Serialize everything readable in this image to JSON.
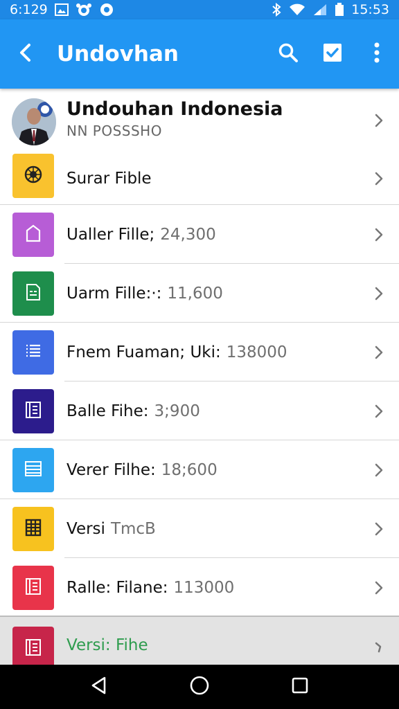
{
  "status_bar": {
    "time_left": "6:129",
    "time_right": "15:53",
    "colors": {
      "background": "#1e88e5"
    }
  },
  "app_bar": {
    "title": "Undovhan",
    "background": "#2196f3",
    "icons": [
      "back-arrow-icon",
      "search-icon",
      "checkbox-icon",
      "more-vert-icon"
    ]
  },
  "profile": {
    "name": "Undouhan Indonesia",
    "subtitle": "NN POSSSHO"
  },
  "items": [
    {
      "label": "Surar Fible",
      "value": "",
      "color": "#f9c22e",
      "icon": "gear-pattern-icon"
    },
    {
      "label": "Ualler Fille;",
      "value": "24,300",
      "color": "#b75dd6",
      "icon": "bag-icon"
    },
    {
      "label": "Uarm Fille:·:",
      "value": "11,600",
      "color": "#1e8e4c",
      "icon": "document-icon"
    },
    {
      "label": "Fnem Fuaman; Uki:",
      "value": "138000",
      "color": "#3f6be4",
      "icon": "list-icon"
    },
    {
      "label": "Balle Fihe:",
      "value": "3;900",
      "color": "#2c1c8c",
      "icon": "book-icon"
    },
    {
      "label": "Verer Filhe:",
      "value": "18;600",
      "color": "#2da6f0",
      "icon": "table-icon"
    },
    {
      "label": "Versi",
      "value": "TmcB",
      "color": "#f7c21f",
      "icon": "grid-icon"
    },
    {
      "label": "Ralle: Filane:",
      "value": "113000",
      "color": "#e8344a",
      "icon": "book-icon"
    },
    {
      "label": "Versi: Fihe",
      "value": "",
      "color": "#c7254a",
      "icon": "book-icon",
      "highlighted": true
    }
  ],
  "nav_bar": {
    "icons": [
      "nav-back-icon",
      "nav-home-icon",
      "nav-recents-icon"
    ]
  }
}
